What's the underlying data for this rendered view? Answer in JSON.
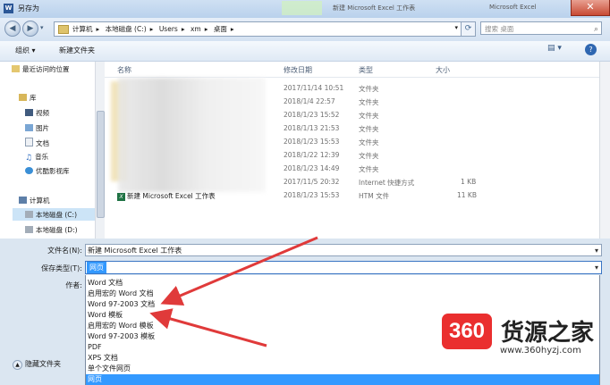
{
  "window": {
    "title": "另存为",
    "title_app_icon": "W",
    "bg_title_a": "新建 Microsoft Excel 工作表",
    "bg_title_b": "Microsoft Excel"
  },
  "address": {
    "crumbs": [
      "计算机",
      "本地磁盘 (C:)",
      "Users",
      "xm",
      "桌面"
    ],
    "search_placeholder": "搜索 桌面"
  },
  "toolbar": {
    "organize": "组织 ▾",
    "new_folder": "新建文件夹"
  },
  "nav": {
    "recent": "最近访问的位置",
    "library": "库",
    "video": "视频",
    "pictures": "图片",
    "docs": "文档",
    "music": "音乐",
    "youku": "优酷影视库",
    "computer": "计算机",
    "disk_c": "本地磁盘 (C:)",
    "disk_d": "本地磁盘 (D:)"
  },
  "columns": {
    "name": "名称",
    "modified": "修改日期",
    "type": "类型",
    "size": "大小"
  },
  "files": [
    {
      "name": "",
      "modified": "2017/11/14 10:51",
      "type": "文件夹",
      "size": ""
    },
    {
      "name": "",
      "modified": "2018/1/4 22:57",
      "type": "文件夹",
      "size": ""
    },
    {
      "name": "",
      "modified": "2018/1/23 15:52",
      "type": "文件夹",
      "size": ""
    },
    {
      "name": "",
      "modified": "2018/1/13 21:53",
      "type": "文件夹",
      "size": ""
    },
    {
      "name": "",
      "modified": "2018/1/23 15:53",
      "type": "文件夹",
      "size": ""
    },
    {
      "name": "",
      "modified": "2018/1/22 12:39",
      "type": "文件夹",
      "size": ""
    },
    {
      "name": "",
      "modified": "2018/1/23 14:49",
      "type": "文件夹",
      "size": ""
    },
    {
      "name": "",
      "modified": "2017/11/5 20:32",
      "type": "Internet 快捷方式",
      "size": "1 KB"
    },
    {
      "name": "新建 Microsoft Excel 工作表",
      "modified": "2018/1/23 15:53",
      "type": "HTM 文件",
      "size": "11 KB"
    }
  ],
  "form": {
    "filename_label": "文件名(N):",
    "filename_value": "新建 Microsoft Excel 工作表",
    "filetype_label": "保存类型(T):",
    "filetype_value": "网页",
    "author_label": "作者:"
  },
  "filetype_options": [
    "Word 文档",
    "启用宏的 Word 文档",
    "Word 97-2003 文档",
    "Word 模板",
    "启用宏的 Word 模板",
    "Word 97-2003 模板",
    "PDF",
    "XPS 文档",
    "单个文件网页",
    "网页"
  ],
  "hide_folders": "隐藏文件夹",
  "watermark": {
    "logo": "360",
    "brand": "货源之家",
    "url": "www.360hyzj.com"
  },
  "colors": {
    "accent": "#3399ff",
    "arrow": "#e03a3a"
  }
}
